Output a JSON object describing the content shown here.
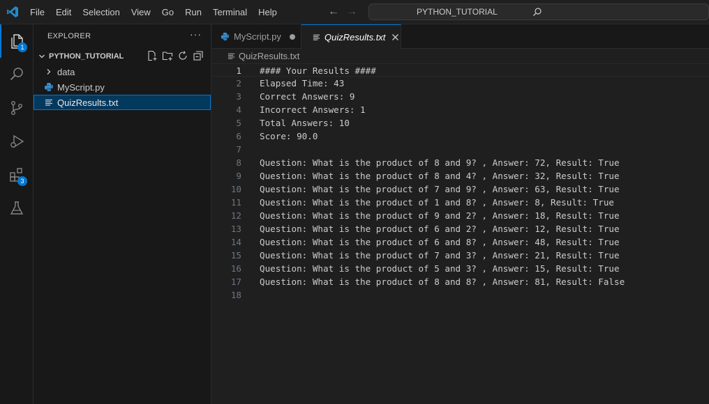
{
  "menu": [
    "File",
    "Edit",
    "Selection",
    "View",
    "Go",
    "Run",
    "Terminal",
    "Help"
  ],
  "search": {
    "text": "PYTHON_TUTORIAL"
  },
  "activity": {
    "explorer_badge": "1",
    "extensions_badge": "3"
  },
  "sidebar": {
    "title": "EXPLORER",
    "more": "···",
    "folder": "PYTHON_TUTORIAL",
    "items": [
      {
        "label": "data"
      },
      {
        "label": "MyScript.py"
      },
      {
        "label": "QuizResults.txt"
      }
    ]
  },
  "tabs": [
    {
      "label": "MyScript.py"
    },
    {
      "label": "QuizResults.txt"
    }
  ],
  "breadcrumb": "QuizResults.txt",
  "editor": {
    "lines": [
      {
        "n": "1",
        "t": "#### Your Results ####"
      },
      {
        "n": "2",
        "t": "Elapsed Time: 43"
      },
      {
        "n": "3",
        "t": "Correct Answers: 9"
      },
      {
        "n": "4",
        "t": "Incorrect Answers: 1"
      },
      {
        "n": "5",
        "t": "Total Answers: 10"
      },
      {
        "n": "6",
        "t": "Score: 90.0"
      },
      {
        "n": "7",
        "t": ""
      },
      {
        "n": "8",
        "t": "Question: What is the product of 8 and 9? , Answer: 72, Result: True"
      },
      {
        "n": "9",
        "t": "Question: What is the product of 8 and 4? , Answer: 32, Result: True"
      },
      {
        "n": "10",
        "t": "Question: What is the product of 7 and 9? , Answer: 63, Result: True"
      },
      {
        "n": "11",
        "t": "Question: What is the product of 1 and 8? , Answer: 8, Result: True"
      },
      {
        "n": "12",
        "t": "Question: What is the product of 9 and 2? , Answer: 18, Result: True"
      },
      {
        "n": "13",
        "t": "Question: What is the product of 6 and 2? , Answer: 12, Result: True"
      },
      {
        "n": "14",
        "t": "Question: What is the product of 6 and 8? , Answer: 48, Result: True"
      },
      {
        "n": "15",
        "t": "Question: What is the product of 7 and 3? , Answer: 21, Result: True"
      },
      {
        "n": "16",
        "t": "Question: What is the product of 5 and 3? , Answer: 15, Result: True"
      },
      {
        "n": "17",
        "t": "Question: What is the product of 8 and 8? , Answer: 81, Result: False"
      },
      {
        "n": "18",
        "t": ""
      }
    ]
  },
  "colors": {
    "accent": "#0078d4",
    "selection_bg": "#04395e",
    "python": "#3b8fd1"
  }
}
